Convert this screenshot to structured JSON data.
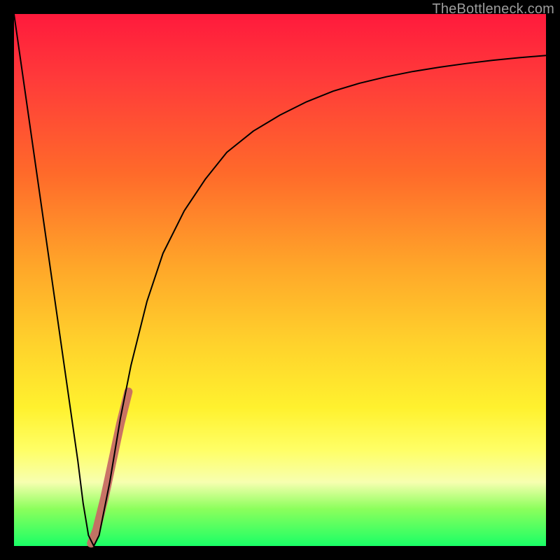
{
  "watermark": {
    "text": "TheBottleneck.com"
  },
  "colors": {
    "highlight": "#c76b64",
    "curve": "#000000",
    "frame": "#000000"
  },
  "chart_data": {
    "type": "line",
    "title": "",
    "xlabel": "",
    "ylabel": "",
    "xlim": [
      0,
      100
    ],
    "ylim": [
      0,
      100
    ],
    "grid": false,
    "legend": false,
    "series": [
      {
        "name": "bottleneck-curve",
        "x": [
          0,
          2,
          4,
          6,
          8,
          10,
          12,
          13,
          14,
          15,
          16,
          18,
          20,
          22,
          25,
          28,
          32,
          36,
          40,
          45,
          50,
          55,
          60,
          65,
          70,
          75,
          80,
          85,
          90,
          95,
          100
        ],
        "y": [
          100,
          86,
          72,
          58,
          44,
          30,
          16,
          8,
          2,
          0,
          2,
          12,
          24,
          34,
          46,
          55,
          63,
          69,
          74,
          78,
          81,
          83.5,
          85.5,
          87,
          88.2,
          89.2,
          90,
          90.7,
          91.3,
          91.8,
          92.2
        ]
      },
      {
        "name": "highlight-segment",
        "x": [
          14.5,
          15.5,
          17.0,
          18.5,
          20.0,
          21.5
        ],
        "y": [
          0.5,
          3.0,
          9.0,
          16.0,
          23.0,
          29.0
        ]
      }
    ]
  }
}
